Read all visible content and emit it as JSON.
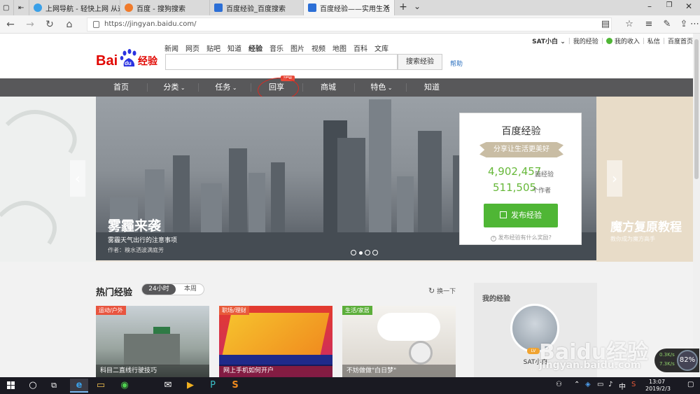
{
  "browser": {
    "tabs": [
      {
        "label": "上网导航 - 轻快上网 从这里",
        "active": false
      },
      {
        "label": "百度 - 搜狗搜索",
        "active": false
      },
      {
        "label": "百度经验_百度搜索",
        "active": false
      },
      {
        "label": "百度经验——实用生活",
        "active": true
      }
    ],
    "new_tab": "+",
    "tab_menu": "⌄",
    "url": "https://jingyan.baidu.com/"
  },
  "site": {
    "logo_text": "Bai",
    "logo_paw": "du",
    "logo_cn": "经验",
    "topnav": [
      "新闻",
      "网页",
      "贴吧",
      "知道",
      "经验",
      "音乐",
      "图片",
      "视频",
      "地图",
      "百科",
      "文库"
    ],
    "topnav_active": "经验",
    "search_placeholder": "",
    "search_button": "搜索经验",
    "help": "帮助",
    "user": {
      "name": "SAT小白",
      "links": [
        "我的经验",
        "我的收入",
        "私信",
        "百度首页"
      ]
    },
    "mainnav": [
      "首页",
      "分类",
      "任务",
      "回享",
      "商城",
      "特色",
      "知道"
    ],
    "mainnav_dropdowns": [
      "分类",
      "任务",
      "特色"
    ],
    "new_badge": "NEW"
  },
  "banner": {
    "title": "雾霾来袭",
    "subtitle": "雾霾天气出行的注意事项",
    "author": "作者：糗水洒波满庭芳",
    "right_title": "魔方复原教程",
    "right_sub": "教你成为魔方高手",
    "dots": 4,
    "active_dot": 1
  },
  "card": {
    "title": "百度经验",
    "slogan": "分享让生活更美好",
    "count1": "4,902,457",
    "unit1": "篇经验",
    "count2": "511,505",
    "unit2": "个作者",
    "publish": "发布经验",
    "footer": "发布经验有什么奖励?"
  },
  "hot": {
    "title": "热门经验",
    "toggle_on": "24小时",
    "toggle_off": "本周",
    "refresh": "换一下",
    "items": [
      {
        "tag": "运动/户外",
        "caption": "科目二直线行驶技巧",
        "tag_color": "#e8553f"
      },
      {
        "tag": "职场/理财",
        "caption": "网上手机如何开户",
        "tag_color": "#e85a3a"
      },
      {
        "tag": "生活/家居",
        "caption": "不妨做做\"白日梦\"",
        "tag_color": "#5cae3a"
      }
    ]
  },
  "my_exp": {
    "title": "我的经验",
    "level": "LV",
    "username": "SAT小白"
  },
  "watermark": {
    "text": "Baidu经验",
    "url": "jingyan.baidu.com"
  },
  "speed_widget": {
    "up": "0.3K/s",
    "down": "7.3K/s",
    "percent": "82%"
  },
  "taskbar": {
    "time": "13:07",
    "date": "2019/2/3",
    "ime": "中"
  }
}
